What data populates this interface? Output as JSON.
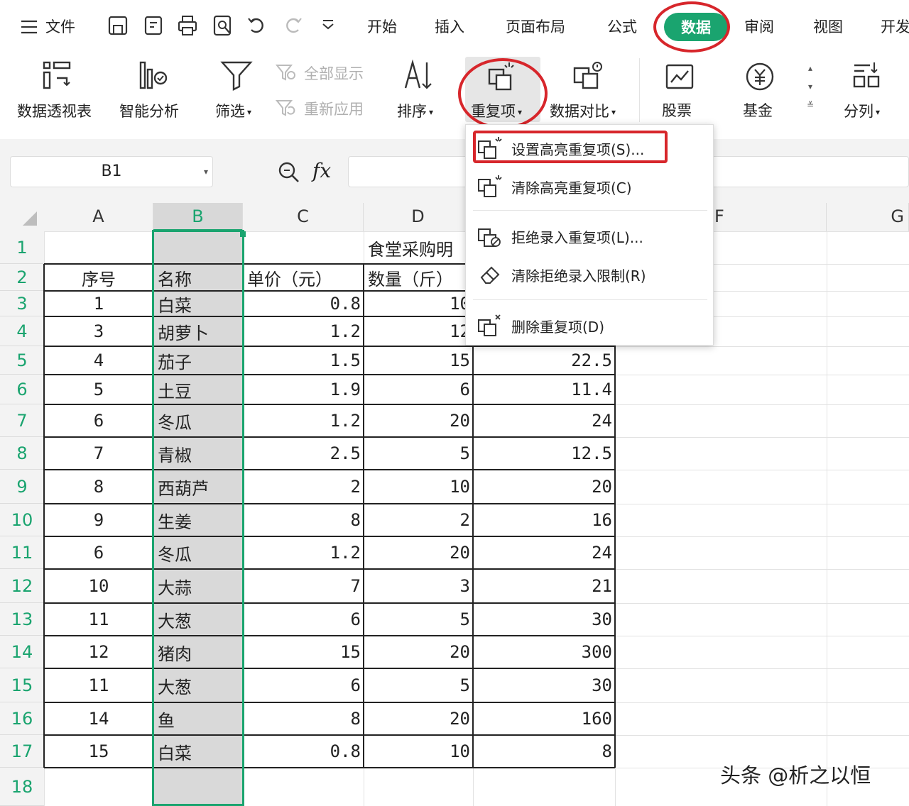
{
  "menubar": {
    "file": "文件",
    "tabs": [
      "开始",
      "插入",
      "页面布局",
      "公式",
      "数据",
      "审阅",
      "视图",
      "开发"
    ],
    "active_tab": "数据"
  },
  "ribbon": {
    "pivot": "数据透视表",
    "smart": "智能分析",
    "filter": "筛选",
    "show_all": "全部显示",
    "reapply": "重新应用",
    "sort": "排序",
    "duplicates": "重复项",
    "compare": "数据对比",
    "stocks": "股票",
    "funds": "基金",
    "split": "分列"
  },
  "formula_bar": {
    "name_box": "B1",
    "fx": "fx"
  },
  "columns": [
    "A",
    "B",
    "C",
    "D",
    "F",
    "G"
  ],
  "rows": [
    "1",
    "2",
    "3",
    "4",
    "5",
    "6",
    "7",
    "8",
    "9",
    "10",
    "11",
    "12",
    "13",
    "14",
    "15",
    "16",
    "17",
    "18"
  ],
  "sheet": {
    "title_cell": "食堂采购明",
    "headers": {
      "a": "序号",
      "b": "名称",
      "c": "单价（元）",
      "d": "数量（斤）"
    },
    "data": [
      {
        "a": "1",
        "b": "白菜",
        "c": "0.8",
        "d": "10",
        "e": ""
      },
      {
        "a": "3",
        "b": "胡萝卜",
        "c": "1.2",
        "d": "12",
        "e": ""
      },
      {
        "a": "4",
        "b": "茄子",
        "c": "1.5",
        "d": "15",
        "e": "22.5"
      },
      {
        "a": "5",
        "b": "土豆",
        "c": "1.9",
        "d": "6",
        "e": "11.4"
      },
      {
        "a": "6",
        "b": "冬瓜",
        "c": "1.2",
        "d": "20",
        "e": "24"
      },
      {
        "a": "7",
        "b": "青椒",
        "c": "2.5",
        "d": "5",
        "e": "12.5"
      },
      {
        "a": "8",
        "b": "西葫芦",
        "c": "2",
        "d": "10",
        "e": "20"
      },
      {
        "a": "9",
        "b": "生姜",
        "c": "8",
        "d": "2",
        "e": "16"
      },
      {
        "a": "6",
        "b": "冬瓜",
        "c": "1.2",
        "d": "20",
        "e": "24"
      },
      {
        "a": "10",
        "b": "大蒜",
        "c": "7",
        "d": "3",
        "e": "21"
      },
      {
        "a": "11",
        "b": "大葱",
        "c": "6",
        "d": "5",
        "e": "30"
      },
      {
        "a": "12",
        "b": "猪肉",
        "c": "15",
        "d": "20",
        "e": "300"
      },
      {
        "a": "11",
        "b": "大葱",
        "c": "6",
        "d": "5",
        "e": "30"
      },
      {
        "a": "14",
        "b": "鱼",
        "c": "8",
        "d": "20",
        "e": "160"
      },
      {
        "a": "15",
        "b": "白菜",
        "c": "0.8",
        "d": "10",
        "e": "8"
      }
    ]
  },
  "dropdown": {
    "items": [
      "设置高亮重复项(S)...",
      "清除高亮重复项(C)",
      "拒绝录入重复项(L)...",
      "清除拒绝录入限制(R)",
      "删除重复项(D)"
    ]
  },
  "watermark": "头条 @析之以恒"
}
